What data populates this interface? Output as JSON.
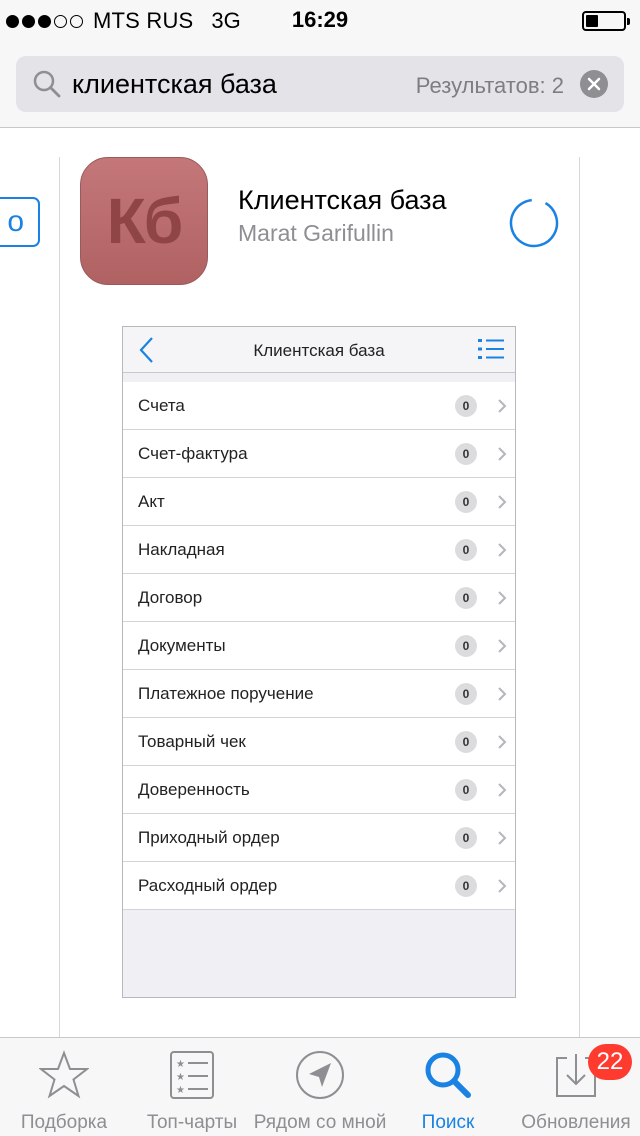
{
  "status_bar": {
    "carrier": "MTS RUS",
    "network": "3G",
    "time": "16:29",
    "signal_bars_filled": 3,
    "signal_bars_total": 5
  },
  "search": {
    "query": "клиентская база",
    "results_label": "Результатов: 2",
    "icon": "search-icon",
    "clear_icon": "clear-icon"
  },
  "prev_card": {
    "button_label": "o"
  },
  "app": {
    "icon_text": "Кб",
    "icon_color": "#b96b6c",
    "name": "Клиентская база",
    "developer": "Marat Garifullin",
    "status_icon": "download-progress-icon"
  },
  "screenshot": {
    "title": "Клиентская база",
    "rows": [
      {
        "label": "Счета",
        "count": "0"
      },
      {
        "label": "Счет-фактура",
        "count": "0"
      },
      {
        "label": "Акт",
        "count": "0"
      },
      {
        "label": "Накладная",
        "count": "0"
      },
      {
        "label": "Договор",
        "count": "0"
      },
      {
        "label": "Документы",
        "count": "0"
      },
      {
        "label": "Платежное поручение",
        "count": "0"
      },
      {
        "label": "Товарный чек",
        "count": "0"
      },
      {
        "label": "Доверенность",
        "count": "0"
      },
      {
        "label": "Приходный ордер",
        "count": "0"
      },
      {
        "label": "Расходный ордер",
        "count": "0"
      }
    ]
  },
  "tabs": [
    {
      "label": "Подборка",
      "icon": "star-icon",
      "active": false
    },
    {
      "label": "Топ-чарты",
      "icon": "list-icon",
      "active": false
    },
    {
      "label": "Рядом со мной",
      "icon": "location-icon",
      "active": false
    },
    {
      "label": "Поиск",
      "icon": "search-icon",
      "active": true
    },
    {
      "label": "Обновления",
      "icon": "updates-icon",
      "active": false,
      "badge": "22"
    }
  ],
  "colors": {
    "accent": "#1a82e2",
    "badge": "#ff3b30",
    "inactive": "#8e8e93"
  }
}
